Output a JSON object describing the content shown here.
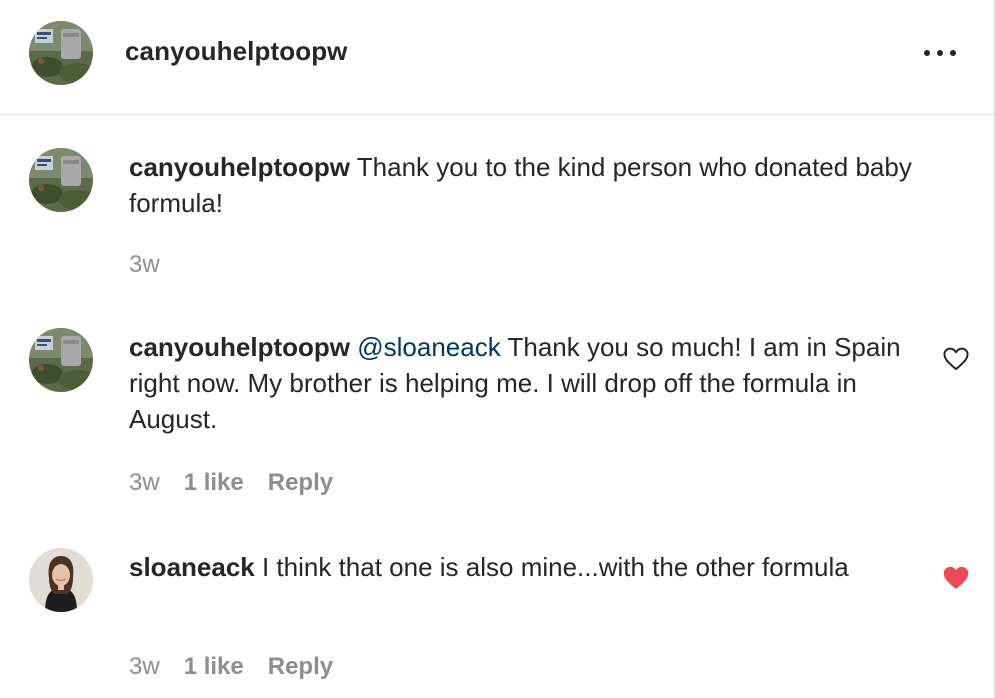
{
  "header": {
    "username": "canyouhelptoopw",
    "more_icon": "more-horizontal-icon"
  },
  "comments": [
    {
      "username": "canyouhelptoopw",
      "mention": "",
      "text": "Thank you to the kind person who donated baby formula!",
      "time": "3w",
      "likes": "",
      "reply": "",
      "liked": false,
      "show_heart": false
    },
    {
      "username": "canyouhelptoopw",
      "mention": "@sloaneack",
      "text": "Thank you so much! I am in Spain right now. My brother is helping me. I will drop off the formula in August.",
      "time": "3w",
      "likes": "1 like",
      "reply": "Reply",
      "liked": false,
      "show_heart": true
    },
    {
      "username": "sloaneack",
      "mention": "",
      "text": "I think that one is also mine...with the other formula",
      "time": "3w",
      "likes": "1 like",
      "reply": "Reply",
      "liked": true,
      "show_heart": true
    }
  ],
  "colors": {
    "heart_liked": "#ed4956",
    "mention": "#00376b",
    "secondary_text": "#8e8e8e"
  }
}
